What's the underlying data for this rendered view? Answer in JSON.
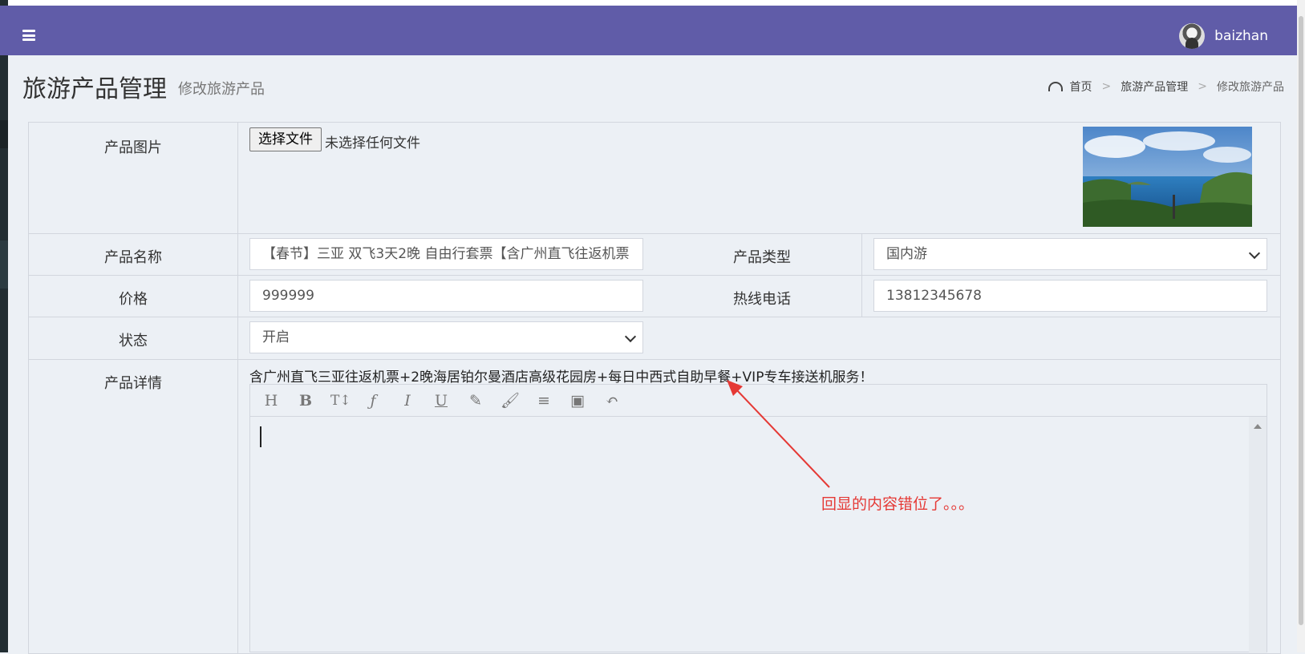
{
  "header": {
    "menu_icon": "hamburger-icon",
    "username": "baizhan"
  },
  "page": {
    "title": "旅游产品管理",
    "subtitle": "修改旅游产品"
  },
  "breadcrumb": {
    "icon": "dashboard-icon",
    "items": [
      "首页",
      "旅游产品管理",
      "修改旅游产品"
    ],
    "separator": ">"
  },
  "form": {
    "image": {
      "label": "产品图片",
      "button_label": "选择文件",
      "file_status": "未选择任何文件"
    },
    "name": {
      "label": "产品名称",
      "value": "【春节】三亚 双飞3天2晚 自由行套票【含广州直飞往返机票"
    },
    "type": {
      "label": "产品类型",
      "value": "国内游"
    },
    "price": {
      "label": "价格",
      "value": "999999"
    },
    "hotline": {
      "label": "热线电话",
      "value": "13812345678"
    },
    "status": {
      "label": "状态",
      "value": "开启"
    },
    "detail": {
      "label": "产品详情",
      "text": "含广州直飞三亚往返机票+2晚海居铂尔曼酒店高级花园房+每日中西式自助早餐+VIP专车接送机服务！",
      "toolbar_icons": [
        "heading-icon",
        "bold-icon",
        "text-size-icon",
        "font-icon",
        "italic-icon",
        "underline-icon",
        "highlighter-icon",
        "brush-icon",
        "align-icon",
        "image-icon",
        "undo-icon"
      ]
    }
  },
  "annotation": {
    "text": "回显的内容错位了。。。",
    "color": "#e53935"
  },
  "colors": {
    "header": "#605ca8",
    "background": "#ecf0f5"
  }
}
